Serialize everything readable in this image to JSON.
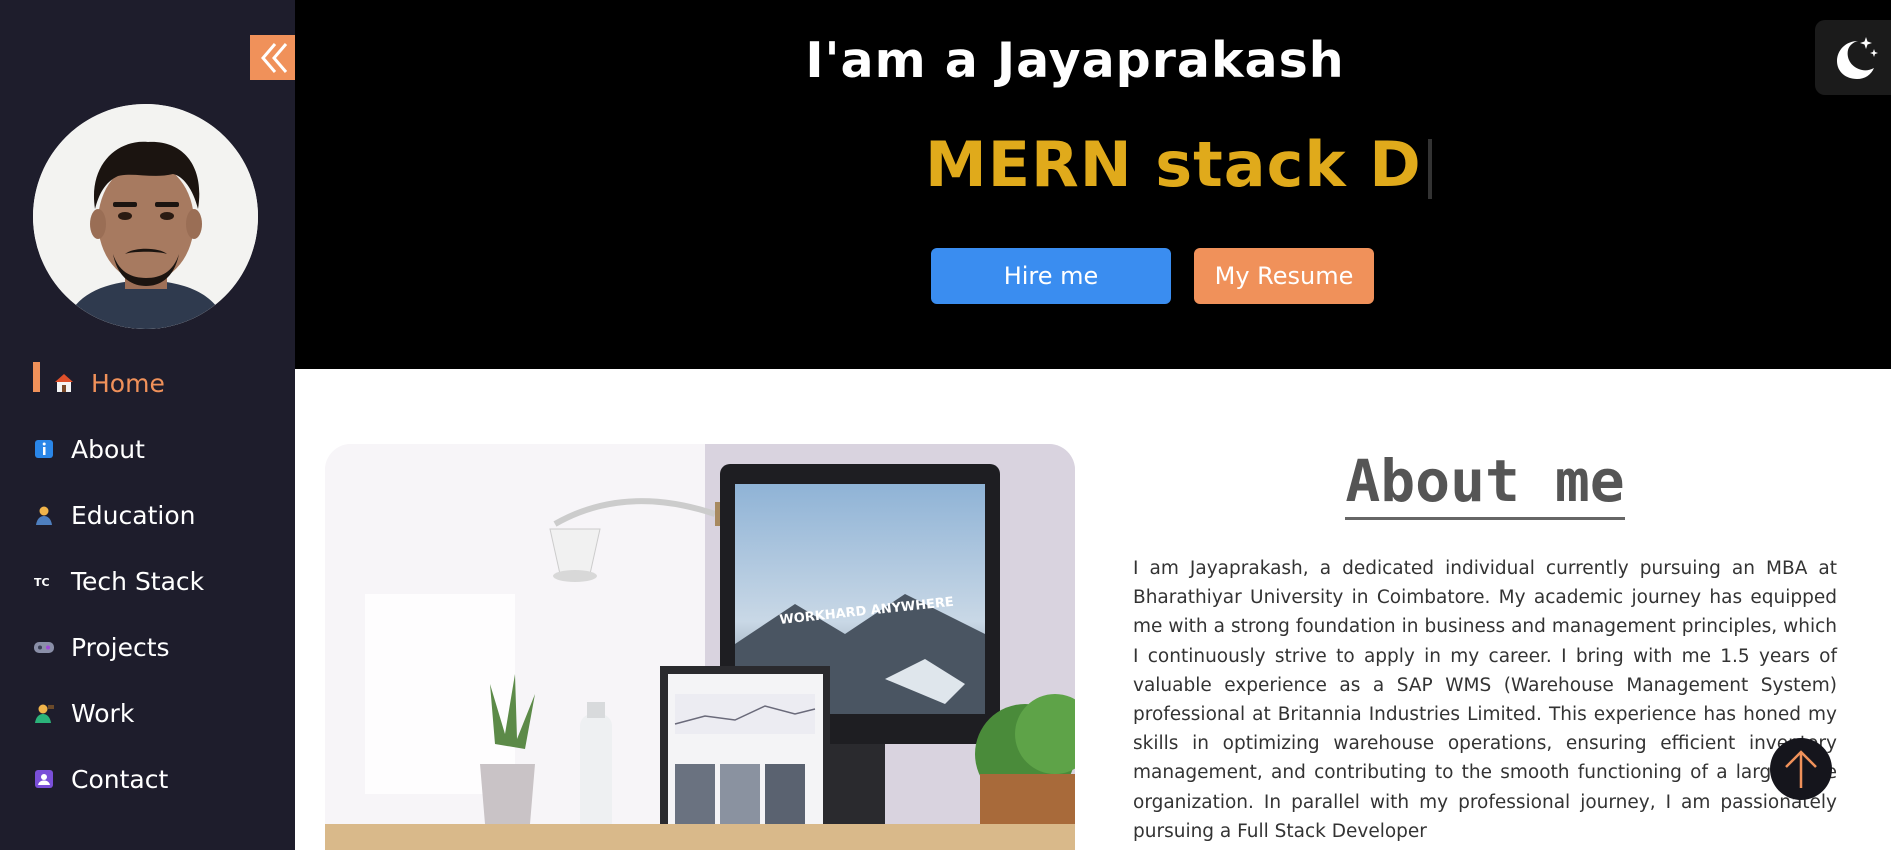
{
  "sidebar": {
    "collapse_icon": "double-chevron-left-icon",
    "accent_color": "#f0915a",
    "background_color": "#1e1d2c",
    "items": [
      {
        "label": "Home",
        "icon": "house-icon",
        "active": true
      },
      {
        "label": "About",
        "icon": "info-icon",
        "active": false
      },
      {
        "label": "Education",
        "icon": "student-icon",
        "active": false
      },
      {
        "label": "Tech Stack",
        "icon": "tech-icon",
        "active": false
      },
      {
        "label": "Projects",
        "icon": "video-game-icon",
        "active": false
      },
      {
        "label": "Work",
        "icon": "worker-icon",
        "active": false
      },
      {
        "label": "Contact",
        "icon": "contact-card-icon",
        "active": false
      }
    ]
  },
  "hero": {
    "title": "I'am a Jayaprakash",
    "typed_text": "MERN stack D",
    "typed_color": "#e0aa1b",
    "hire_button": "Hire me",
    "resume_button": "My Resume",
    "hire_color": "#3a8df0",
    "resume_color": "#f0915a"
  },
  "theme_toggle": {
    "icon": "moon-stars-icon"
  },
  "about": {
    "heading": "About me",
    "image_caption": "WORKHARD ANYWHERE",
    "paragraph": "I am Jayaprakash, a dedicated individual currently pursuing an MBA at Bharathiyar University in Coimbatore. My academic journey has equipped me with a strong foundation in business and management principles, which I continuously strive to apply in my career. I bring with me 1.5 years of valuable experience as a SAP WMS (Warehouse Management System) professional at Britannia Industries Limited. This experience has honed my skills in optimizing warehouse operations, ensuring efficient inventory management, and contributing to the smooth functioning of a large-scale organization. In parallel with my professional journey, I am passionately pursuing a Full Stack Developer"
  },
  "scroll_top": {
    "icon": "arrow-up-icon"
  }
}
